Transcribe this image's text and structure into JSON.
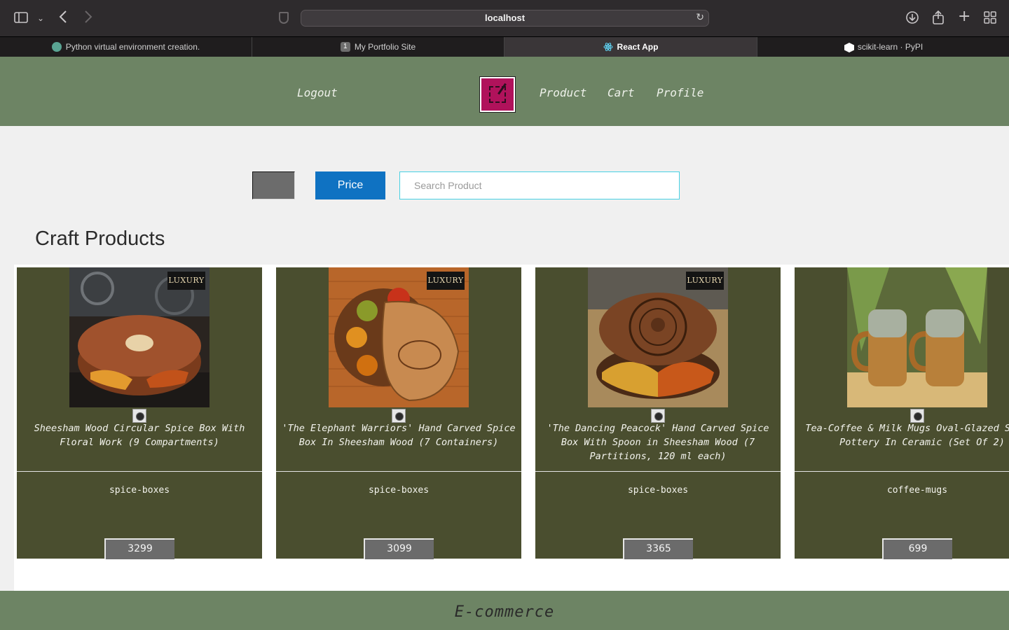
{
  "browser": {
    "url": "localhost",
    "tabs": [
      {
        "label": "Python virtual environment creation.",
        "icon": "chatgpt-icon"
      },
      {
        "label": "My Portfolio Site",
        "icon": "number-1-icon",
        "icon_text": "1"
      },
      {
        "label": "React App",
        "icon": "react-icon",
        "active": true
      },
      {
        "label": "scikit-learn · PyPI",
        "icon": "pypi-icon"
      }
    ]
  },
  "header": {
    "logout": "Logout",
    "nav": [
      "Product",
      "Cart",
      "Profile"
    ]
  },
  "filters": {
    "price_button": "Price",
    "search_placeholder": "Search Product"
  },
  "section_title": "Craft Products",
  "products": [
    {
      "name": "Sheesham Wood Circular Spice Box With Floral Work (9 Compartments)",
      "category": "spice-boxes",
      "price": "3299",
      "badge": "LUXURY"
    },
    {
      "name": "'The Elephant Warriors' Hand Carved Spice Box In Sheesham Wood (7 Containers)",
      "category": "spice-boxes",
      "price": "3099",
      "badge": "LUXURY"
    },
    {
      "name": "'The Dancing Peacock' Hand Carved Spice Box With Spoon in Sheesham Wood (7 Partitions, 120 ml each)",
      "category": "spice-boxes",
      "price": "3365",
      "badge": "LUXURY"
    },
    {
      "name": "Tea-Coffee & Milk Mugs Oval-Glazed Studio Pottery In Ceramic (Set Of 2)",
      "category": "coffee-mugs",
      "price": "699"
    }
  ],
  "footer": "E-commerce",
  "colors": {
    "header_bg": "#6d8464",
    "card_bg": "#4a4e2f",
    "price_button_bg": "#0f72c2",
    "search_border": "#48d1e3",
    "logo_bg": "#b0125b"
  }
}
